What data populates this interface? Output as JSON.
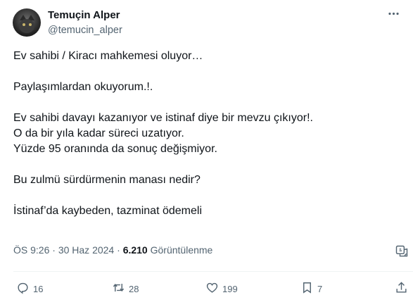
{
  "author": {
    "name": "Temuçin Alper",
    "handle": "@temucin_alper"
  },
  "body_lines": [
    "Ev sahibi / Kiracı mahkemesi oluyor…",
    "",
    "Paylaşımlardan okuyorum.!.",
    "",
    "Ev sahibi davayı kazanıyor ve istinaf diye bir mevzu çıkıyor!.",
    "O da bir yıla kadar süreci uzatıyor.",
    "Yüzde 95 oranında da sonuç değişmiyor.",
    "",
    "Bu zulmü sürdürmenin manası nedir?",
    "",
    "İstinaf’da kaybeden, tazminat ödemeli"
  ],
  "meta": {
    "time": "ÖS 9:26",
    "sep1": "·",
    "date": "30 Haz 2024",
    "sep2": "·",
    "views": "6.210",
    "views_label": "Görüntülenme"
  },
  "actions": {
    "replies": "16",
    "reposts": "28",
    "likes": "199",
    "bookmarks": "7"
  },
  "icons": [
    "more-icon",
    "grok-icon",
    "reply-icon",
    "repost-icon",
    "like-icon",
    "bookmark-icon",
    "share-icon"
  ],
  "colors": {
    "text": "#0f1419",
    "secondary": "#536471",
    "divider": "#eff3f4"
  }
}
